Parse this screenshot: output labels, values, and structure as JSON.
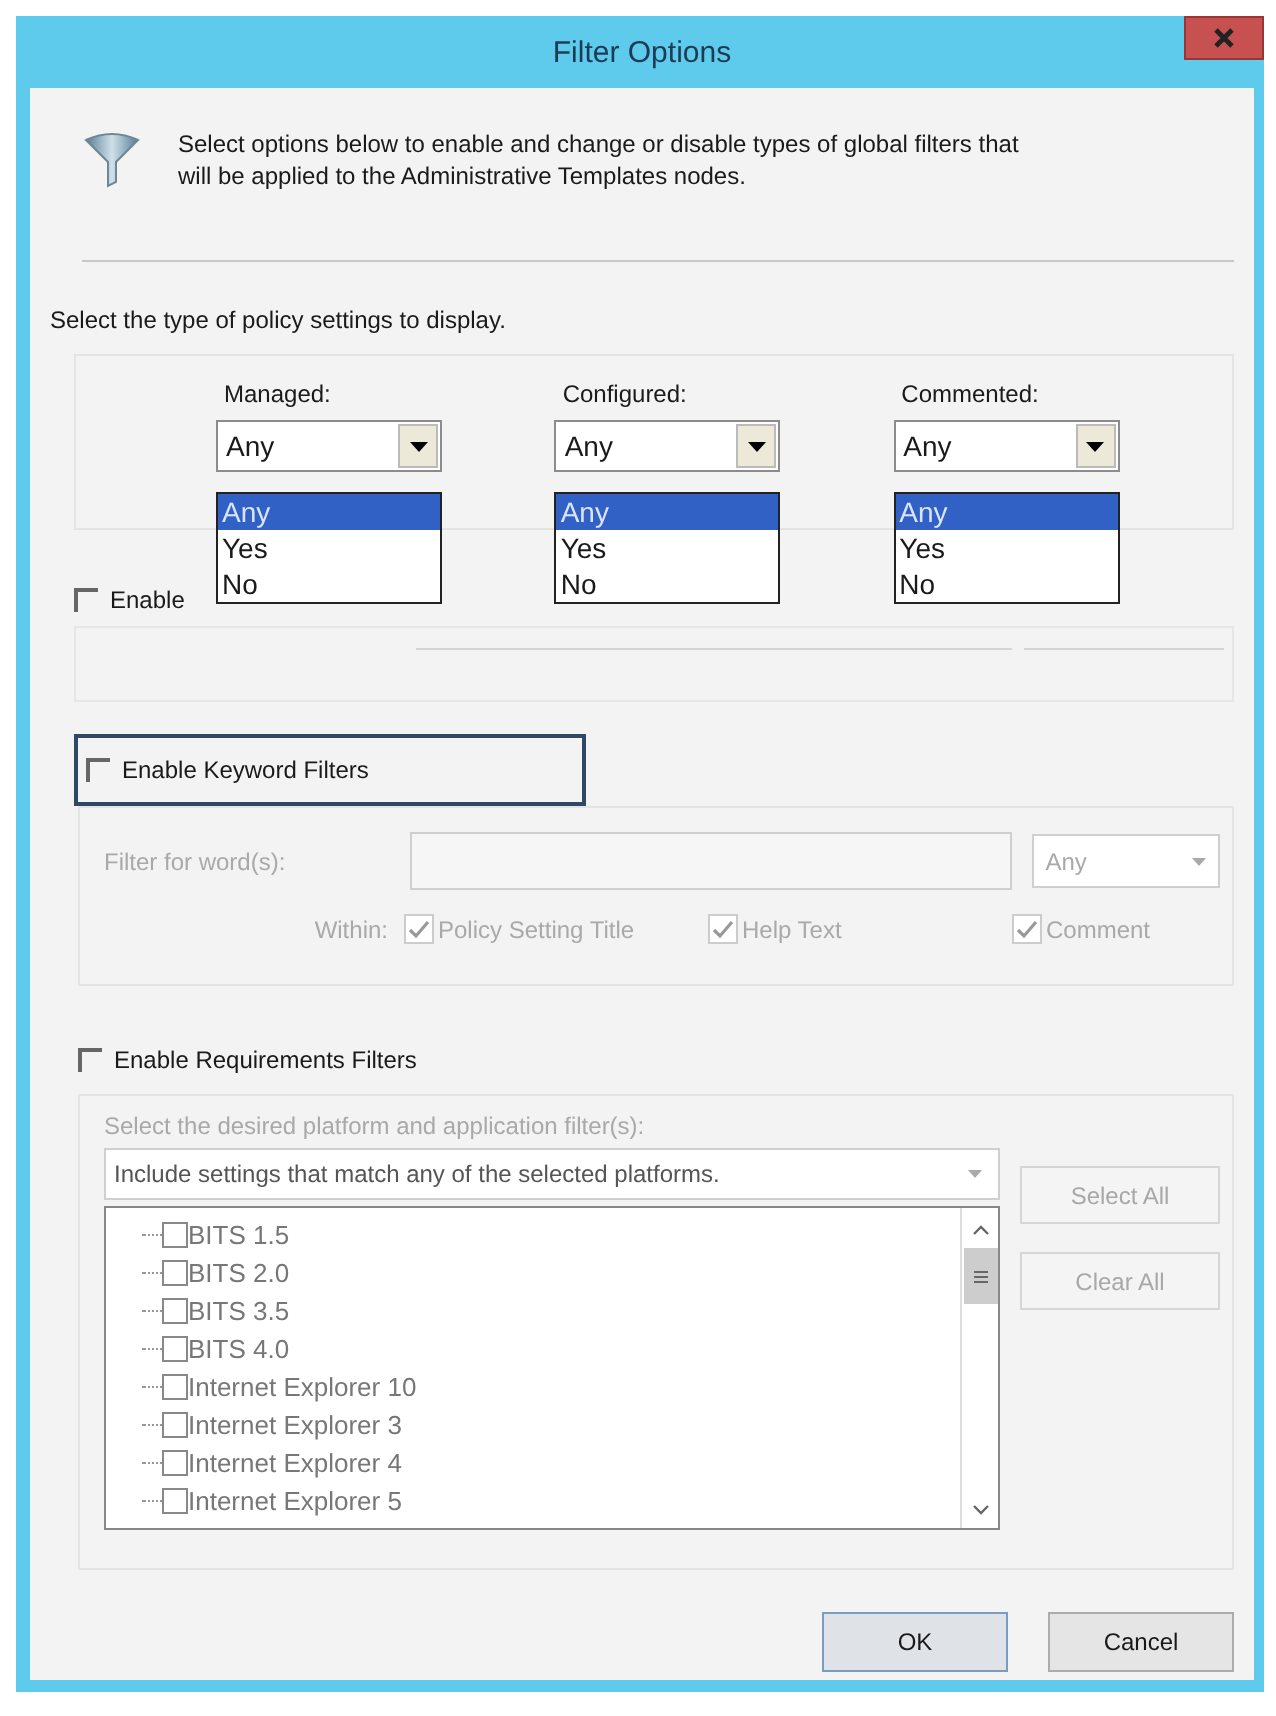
{
  "window": {
    "title": "Filter Options"
  },
  "intro": "Select options below to enable and change or disable types of global filters that will be applied to the Administrative Templates nodes.",
  "policy_prompt": "Select the type of policy settings to display.",
  "dropdowns": [
    {
      "label": "Managed:",
      "value": "Any",
      "expanded": true,
      "options": [
        {
          "label": "Any",
          "selected": true
        },
        {
          "label": "Yes",
          "selected": false
        },
        {
          "label": "No",
          "selected": false
        }
      ]
    },
    {
      "label": "Configured:",
      "value": "Any",
      "expanded": true,
      "options": [
        {
          "label": "Any",
          "selected": true
        },
        {
          "label": "Yes",
          "selected": false
        },
        {
          "label": "No",
          "selected": false
        }
      ]
    },
    {
      "label": "Commented:",
      "value": "Any",
      "expanded": true,
      "options": [
        {
          "label": "Any",
          "selected": true
        },
        {
          "label": "Yes",
          "selected": false
        },
        {
          "label": "No",
          "selected": false
        }
      ]
    }
  ],
  "covered_checkbox": {
    "label": "Enable",
    "checked": false
  },
  "keyword_filters": {
    "label": "Enable Keyword Filters",
    "checked": false,
    "focused": true,
    "disabled": true,
    "filter_label": "Filter for word(s):",
    "match": "Any",
    "within_label": "Within:",
    "within": [
      {
        "label": "Policy Setting Title",
        "checked": true
      },
      {
        "label": "Help Text",
        "checked": true
      },
      {
        "label": "Comment",
        "checked": true
      }
    ]
  },
  "requirements_filters": {
    "label": "Enable Requirements Filters",
    "checked": false,
    "disabled": true,
    "platform_label": "Select the desired platform and application filter(s):",
    "platform_mode": "Include settings that match any of the selected platforms.",
    "platforms": [
      {
        "label": "BITS 1.5",
        "checked": false
      },
      {
        "label": "BITS 2.0",
        "checked": false
      },
      {
        "label": "BITS 3.5",
        "checked": false
      },
      {
        "label": "BITS 4.0",
        "checked": false
      },
      {
        "label": "Internet Explorer 10",
        "checked": false
      },
      {
        "label": "Internet Explorer 3",
        "checked": false
      },
      {
        "label": "Internet Explorer 4",
        "checked": false
      },
      {
        "label": "Internet Explorer 5",
        "checked": false
      }
    ],
    "buttons": [
      "Select All",
      "Clear All"
    ]
  },
  "buttons": [
    "OK",
    "Cancel"
  ]
}
